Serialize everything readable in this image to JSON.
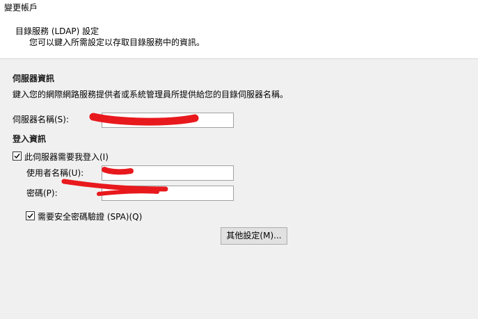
{
  "window": {
    "title": "變更帳戶"
  },
  "header": {
    "title": "目錄服務 (LDAP) 設定",
    "description": "您可以鍵入所需設定以存取目錄服務中的資訊。"
  },
  "server_info": {
    "section_title": "伺服器資訊",
    "description": "鍵入您的網際網路服務提供者或系統管理員所提供給您的目錄伺服器名稱。",
    "server_name_label": "伺服器名稱(S):",
    "server_name_value": ""
  },
  "login_info": {
    "section_title": "登入資訊",
    "requires_login_label": "此伺服器需要我登入(I)",
    "requires_login_checked": true,
    "username_label": "使用者名稱(U):",
    "username_value": "",
    "password_label": "密碼(P):",
    "password_value": "",
    "spa_label": "需要安全密碼驗證 (SPA)(Q)",
    "spa_checked": true
  },
  "buttons": {
    "more_settings": "其他設定(M)..."
  },
  "colors": {
    "redaction": "#e8191d",
    "panel_bg": "#f0f0f0",
    "header_bg": "#ffffff"
  }
}
